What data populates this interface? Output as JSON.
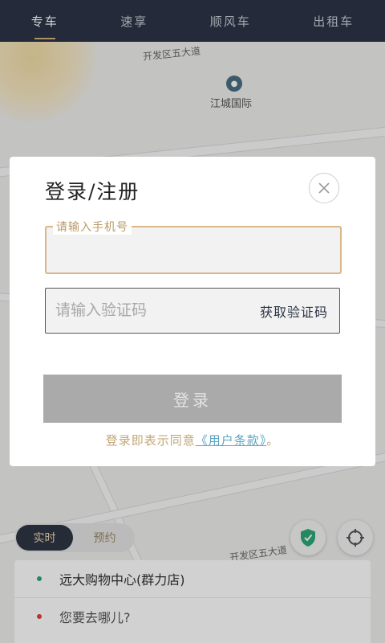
{
  "tabs": [
    {
      "label": "专车",
      "active": true
    },
    {
      "label": "速享",
      "active": false
    },
    {
      "label": "顺风车",
      "active": false
    },
    {
      "label": "出租车",
      "active": false
    }
  ],
  "map": {
    "poi_label": "江城国际",
    "road_label_top": "开发区五大道",
    "road_label_bottom": "开发区五大道"
  },
  "mode_toggle": {
    "realtime": "实时",
    "reserve": "预约"
  },
  "addresses": {
    "origin": "远大购物中心(群力店)",
    "destination": "您要去哪儿?"
  },
  "login_modal": {
    "title": "登录/注册",
    "phone_placeholder": "请输入手机号",
    "code_placeholder": "请输入验证码",
    "get_code_label": "获取验证码",
    "login_label": "登录",
    "terms_prefix": "登录即表示同意",
    "terms_link": "《用户条款》",
    "terms_suffix": "。"
  },
  "colors": {
    "topbar": "#2d3446",
    "accent_gold": "#d7b886",
    "login_disabled": "#aaaaaa",
    "link_blue": "#5ca5c2",
    "origin_dot": "#2aa876",
    "destination_dot": "#e0413a"
  },
  "icons": {
    "close": "close-icon",
    "shield": "shield-icon",
    "locate": "locate-icon"
  }
}
